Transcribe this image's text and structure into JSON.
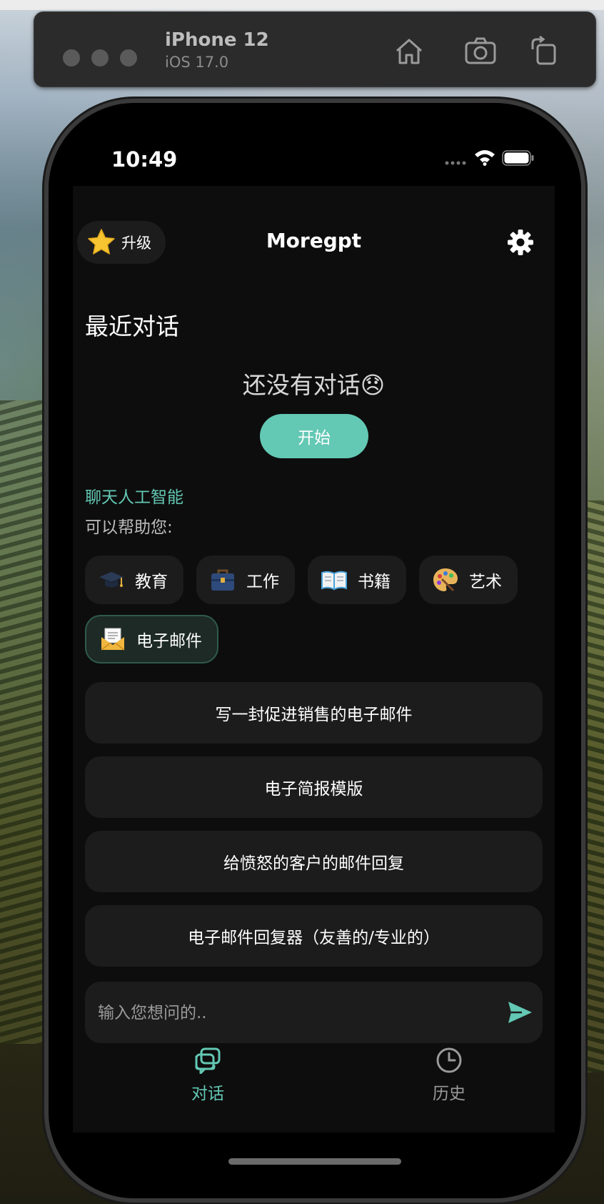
{
  "simulator": {
    "device_name": "iPhone 12",
    "os_version": "iOS 17.0"
  },
  "status_bar": {
    "time": "10:49"
  },
  "header": {
    "upgrade_label": "升级",
    "title": "Moregpt"
  },
  "recent": {
    "section_title": "最近对话",
    "empty_text": "还没有对话😞",
    "start_button": "开始"
  },
  "assistant": {
    "label": "聊天人工智能",
    "help_text": "可以帮助您:"
  },
  "categories": [
    {
      "label": "教育",
      "icon": "graduation-cap-icon"
    },
    {
      "label": "工作",
      "icon": "briefcase-icon"
    },
    {
      "label": "书籍",
      "icon": "open-book-icon"
    },
    {
      "label": "艺术",
      "icon": "palette-icon"
    },
    {
      "label": "电子邮件",
      "icon": "envelope-icon",
      "selected": true
    }
  ],
  "prompts": [
    "写一封促进销售的电子邮件",
    "电子简报模版",
    "给愤怒的客户的邮件回复",
    "电子邮件回复器（友善的/专业的）"
  ],
  "input": {
    "placeholder": "输入您想问的.."
  },
  "tabs": [
    {
      "label": "对话",
      "active": true
    },
    {
      "label": "历史",
      "active": false
    }
  ],
  "colors": {
    "accent": "#63c8b4",
    "background": "#0d0d0d",
    "card": "#1c1c1c"
  }
}
